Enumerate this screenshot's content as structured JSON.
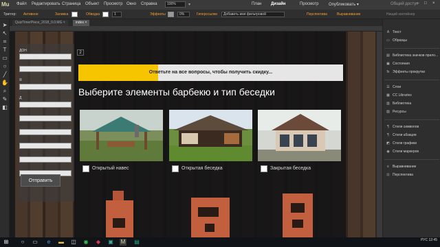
{
  "app": {
    "logo": "Mu"
  },
  "menu": [
    "Файл",
    "Редактировать",
    "Страница",
    "Объект",
    "Просмотр",
    "Окно",
    "Справка"
  ],
  "zoom": "100%",
  "modes": {
    "plan": "План",
    "design": "Дизайн",
    "preview": "Просмотр",
    "publish": "Опубликовать ▾",
    "share": "Общий доступ"
  },
  "options": {
    "trigger_label": "Триггер:",
    "trigger_value": "Активное",
    "fill_label": "Заливка",
    "stroke_label": "Обводка",
    "stroke_value": "1",
    "effects_label": "Эффекты",
    "opacity_value": "0%",
    "hyperlinks_label": "Гиперссылки",
    "add_name_placeholder": "Добавить имя фильтровой",
    "perspective_label": "Перспектива",
    "align_label": "Выравнивание",
    "none_label": "Нищий контейнер"
  },
  "tabs": [
    {
      "label": "QuizTimerPiece_2018_0.0.MG ×"
    },
    {
      "label": "index ×"
    }
  ],
  "form": {
    "field_labels": [
      "ДОН",
      "Я",
      "Д"
    ],
    "send_label": "Отправить"
  },
  "page": {
    "step_number": "2",
    "progress_text": "Ответьте на все вопросы, чтобы получить скидку...",
    "progress_fraction": 0.3,
    "heading": "Выберите элементы барбекю и тип беседки"
  },
  "cards": [
    {
      "label": "Открытый навес"
    },
    {
      "label": "Открытая беседка"
    },
    {
      "label": "Закрытая беседка"
    }
  ],
  "panel": {
    "items": [
      {
        "icon": "A",
        "label": "Текст"
      },
      {
        "icon": "▭",
        "label": "Образцы"
      },
      {
        "icon": "▤",
        "label": "Библиотека значков прило..."
      },
      {
        "icon": "▣",
        "label": "Состояния"
      },
      {
        "icon": "fx",
        "label": "Эффекты прокрутки"
      },
      {
        "icon": "☰",
        "label": "Слои"
      },
      {
        "icon": "▦",
        "label": "CC Libraries"
      },
      {
        "icon": "▥",
        "label": "Библиотека"
      },
      {
        "icon": "▧",
        "label": "Ресурсы"
      },
      {
        "icon": "¶",
        "label": "Стили символов"
      },
      {
        "icon": "¶",
        "label": "Стили абзацев"
      },
      {
        "icon": "◩",
        "label": "Стили графики"
      },
      {
        "icon": "◉",
        "label": "Стили маркеров"
      },
      {
        "icon": "≡",
        "label": "Выравнивание"
      },
      {
        "icon": "⊡",
        "label": "Перспектива"
      }
    ]
  },
  "taskbar": {
    "time": "12:45",
    "date": "РУС",
    "lang": "РУС"
  },
  "colors": {
    "accent_yellow": "#f6c500",
    "trigger_orange": "#f0a030"
  }
}
